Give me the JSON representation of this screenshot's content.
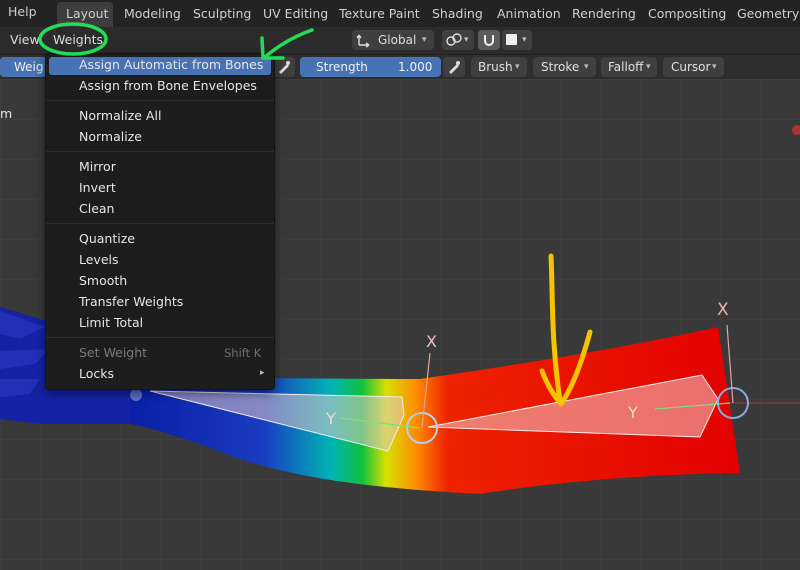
{
  "topbar": {
    "help": "Help",
    "tabs": [
      "Layout",
      "Modeling",
      "Sculpting",
      "UV Editing",
      "Texture Paint",
      "Shading",
      "Animation",
      "Rendering",
      "Compositing",
      "Geometry N"
    ]
  },
  "header": {
    "view": "View",
    "weights": "Weights",
    "orientation": "Global"
  },
  "toolbar": {
    "weight_cut": "Weig",
    "strength_label": "Strength",
    "strength_value": "1.000",
    "brush": "Brush",
    "stroke": "Stroke",
    "falloff": "Falloff",
    "cursor": "Cursor"
  },
  "viewport": {
    "left_cut_text": "m",
    "bone_axis_x": "X",
    "bone_axis_y": "Y"
  },
  "menu": {
    "items": [
      "Assign Automatic from Bones",
      "Assign from Bone Envelopes",
      "Normalize All",
      "Normalize",
      "Mirror",
      "Invert",
      "Clean",
      "Quantize",
      "Levels",
      "Smooth",
      "Transfer Weights",
      "Limit Total",
      "Set Weight",
      "Locks"
    ],
    "set_weight_shortcut": "Shift K"
  },
  "annotations": {
    "circle_color": "#22dd55",
    "arrow_green_color": "#22dd55",
    "arrow_yellow_color": "#f5c400"
  }
}
